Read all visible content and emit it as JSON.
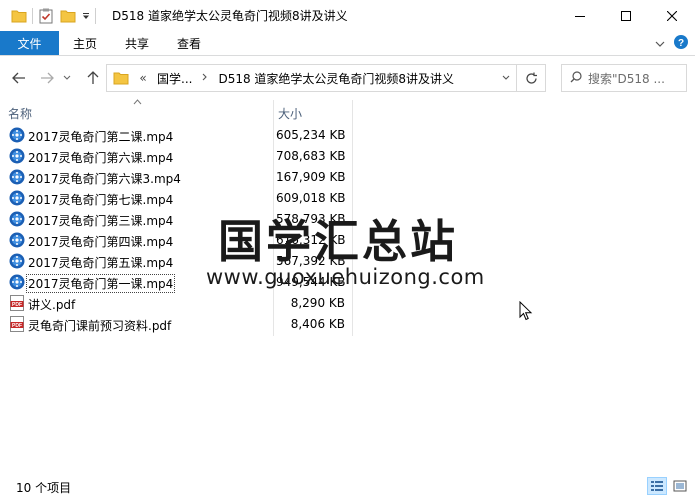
{
  "window": {
    "title": "D518 道家绝学太公灵龟奇门视频8讲及讲义",
    "controls": [
      "minimize-icon",
      "maximize-icon",
      "close-icon"
    ]
  },
  "ribbon": {
    "tabs": [
      {
        "label": "文件",
        "active": true
      },
      {
        "label": "主页"
      },
      {
        "label": "共享"
      },
      {
        "label": "查看"
      }
    ]
  },
  "address": {
    "overflow": "«",
    "crumbs": [
      "国学...",
      "D518 道家绝学太公灵龟奇门视频8讲及讲义"
    ]
  },
  "search": {
    "placeholder": "搜索\"D518 ..."
  },
  "columns": {
    "name": "名称",
    "size": "大小"
  },
  "files": [
    {
      "name": "2017灵龟奇门第二课.mp4",
      "size": "605,234 KB",
      "type": "video"
    },
    {
      "name": "2017灵龟奇门第六课.mp4",
      "size": "708,683 KB",
      "type": "video"
    },
    {
      "name": "2017灵龟奇门第六课3.mp4",
      "size": "167,909 KB",
      "type": "video"
    },
    {
      "name": "2017灵龟奇门第七课.mp4",
      "size": "609,018 KB",
      "type": "video"
    },
    {
      "name": "2017灵龟奇门第三课.mp4",
      "size": "578,793 KB",
      "type": "video"
    },
    {
      "name": "2017灵龟奇门第四课.mp4",
      "size": "616,312 KB",
      "type": "video"
    },
    {
      "name": "2017灵龟奇门第五课.mp4",
      "size": "567,392 KB",
      "type": "video"
    },
    {
      "name": "2017灵龟奇门第一课.mp4",
      "size": "949,544 KB",
      "type": "video",
      "focused": true
    },
    {
      "name": "讲义.pdf",
      "size": "8,290 KB",
      "type": "pdf"
    },
    {
      "name": "灵龟奇门课前预习资料.pdf",
      "size": "8,406 KB",
      "type": "pdf"
    }
  ],
  "watermark": {
    "cn": "国学汇总站",
    "url": "www.guoxuehuizong.com"
  },
  "status": {
    "count": "10 个项目"
  },
  "colors": {
    "accent": "#1979ca",
    "video_icon": "#1b5fb4",
    "pdf_icon": "#c62828"
  }
}
